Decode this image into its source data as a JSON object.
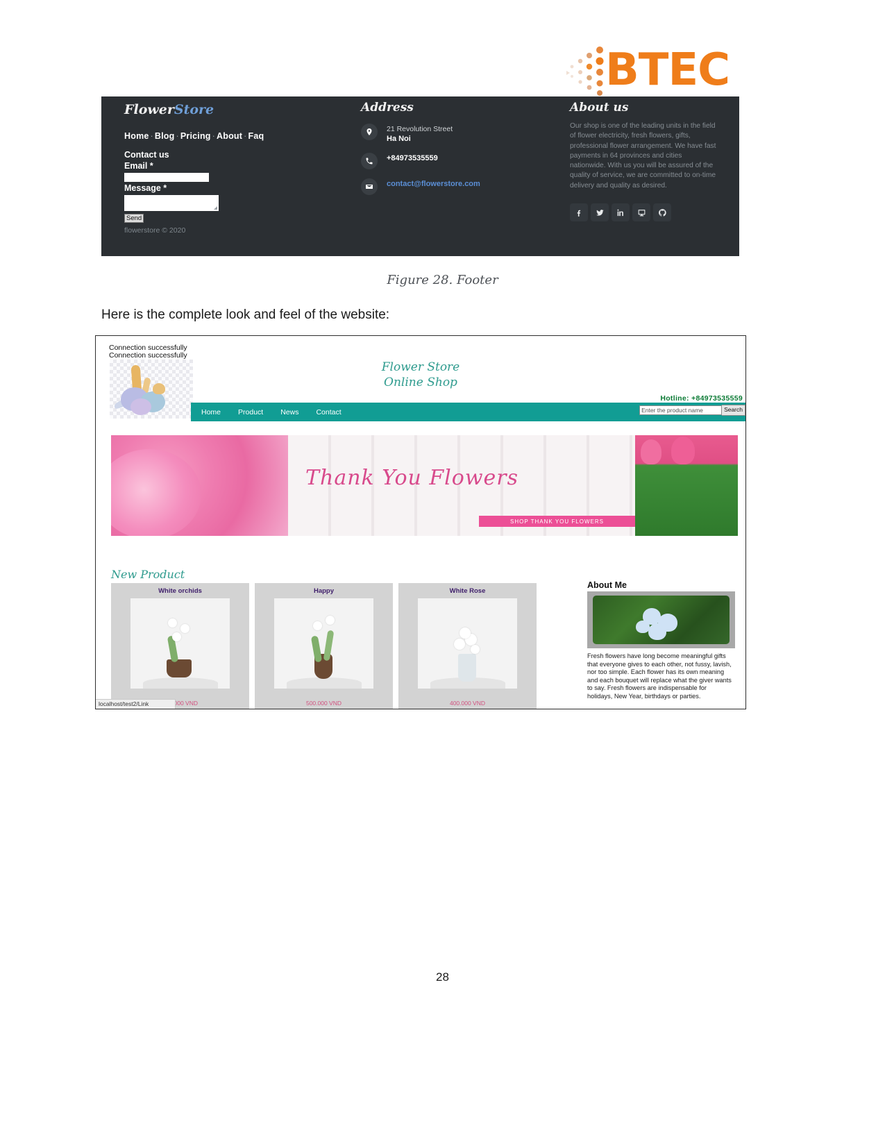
{
  "document": {
    "page_number": "28",
    "body_text": "Here is the complete look and feel of the website:",
    "figure_caption": "Figure 28. Footer"
  },
  "logo": {
    "text": "BTEC",
    "color": "#ef7d1a"
  },
  "footer_figure": {
    "background": "#2b2f33",
    "brand": {
      "part1": "Flower",
      "part2": "Store"
    },
    "nav": [
      "Home",
      "Blog",
      "Pricing",
      "About",
      "Faq"
    ],
    "nav_separator": "·",
    "contact_heading": "Contact us",
    "email_label": "Email *",
    "email_value": "",
    "message_label": "Message *",
    "message_value": "",
    "send_label": "Send",
    "copyright": "flowerstore © 2020",
    "address": {
      "heading": "Address",
      "street": "21 Revolution Street",
      "city": "Ha Noi",
      "phone": "+84973535559",
      "email": "contact@flowerstore.com",
      "email_color": "#5b8fd6"
    },
    "about": {
      "heading": "About us",
      "text": "Our shop is one of the leading units in the field of flower electricity, fresh flowers, gifts, professional flower arrangement. We have fast payments in 64 provinces and cities nationwide. With us you will be assured of the quality of service, we are committed to on-time delivery and quality as desired.",
      "social": [
        "facebook-icon",
        "twitter-icon",
        "linkedin-icon",
        "monitor-icon",
        "github-icon"
      ]
    }
  },
  "website": {
    "connection_messages": [
      "Connection successfully",
      "Connection successfully"
    ],
    "title_line1": "Flower Store",
    "title_line2": "Online Shop",
    "title_color": "#2e9b8e",
    "hotline_label": "Hotline:",
    "hotline_number": "+84973535559",
    "nav": [
      "Home",
      "Product",
      "News",
      "Contact"
    ],
    "nav_background": "#119d94",
    "search_placeholder": "Enter the product name",
    "search_value": "",
    "search_button": "Search",
    "hero": {
      "headline": "Thank You Flowers",
      "cta": "SHOP THANK YOU FLOWERS"
    },
    "new_product_heading": "New Product",
    "products": [
      {
        "name": "White orchids",
        "price": "300.000 VND"
      },
      {
        "name": "Happy",
        "price": "500.000 VND"
      },
      {
        "name": "White Rose",
        "price": "400.000 VND"
      }
    ],
    "about_me": {
      "heading": "About Me",
      "text": "Fresh flowers have long become meaningful gifts that everyone gives to each other, not fussy, lavish, nor too simple. Each flower has its own meaning and each bouquet will replace what the giver wants to say. Fresh flowers are indispensable for holidays, New Year, birthdays or parties."
    },
    "status_bar": "localhost/test2/Link"
  }
}
